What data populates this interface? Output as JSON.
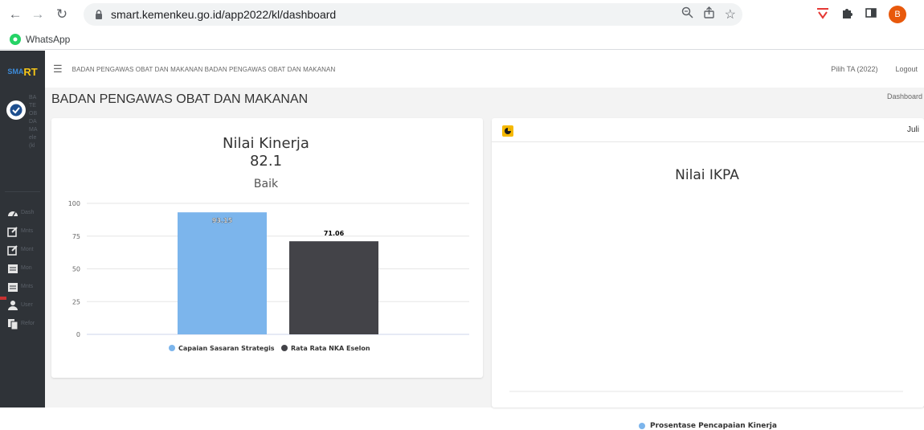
{
  "browser": {
    "url": "smart.kemenkeu.go.id/app2022/kl/dashboard",
    "bookmark_label": "WhatsApp",
    "profile_initial": "B"
  },
  "sidebar": {
    "logo_left": "SMA",
    "logo_right": "RT",
    "user_lines": [
      "BA",
      "TE",
      "OB",
      "DA",
      "MA",
      "ele",
      "(kl"
    ],
    "menu": [
      {
        "icon": "dashboard-icon",
        "label": "Dash"
      },
      {
        "icon": "edit-icon",
        "label": "Mnts"
      },
      {
        "icon": "edit-icon",
        "label": "Mont"
      },
      {
        "icon": "report-icon",
        "label": "Mon"
      },
      {
        "icon": "report-icon",
        "label": "Mnts"
      },
      {
        "icon": "user-icon",
        "label": "User"
      },
      {
        "icon": "copy-icon",
        "label": "Refor"
      }
    ]
  },
  "topbar": {
    "title": "BADAN PENGAWAS OBAT DAN MAKANAN BADAN PENGAWAS OBAT DAN MAKANAN",
    "year_select": "Pilih TA (2022)",
    "logout": "Logout"
  },
  "page": {
    "title": "BADAN PENGAWAS OBAT DAN MAKANAN",
    "breadcrumb": "Dashboard"
  },
  "kinerja": {
    "title": "Nilai Kinerja",
    "score": "82.1",
    "grade": "Baik"
  },
  "ikpa": {
    "month": "Juli",
    "title": "Nilai IKPA",
    "legend": "Prosentase Pencapaian Kinerja",
    "legend_color": "#7cb5ec"
  },
  "chart_data": {
    "type": "bar",
    "categories": [
      "Capaian Sasaran Strategis",
      "Rata Rata NKA Eselon"
    ],
    "values": [
      93.15,
      71.06
    ],
    "data_labels": [
      "93.15",
      "71.06"
    ],
    "colors": [
      "#7cb5ec",
      "#434348"
    ],
    "y_ticks": [
      0,
      25,
      50,
      75,
      100
    ],
    "ylim": [
      0,
      100
    ],
    "legend": [
      "Capaian Sasaran Strategis",
      "Rata Rata NKA Eselon"
    ],
    "grid": true
  }
}
